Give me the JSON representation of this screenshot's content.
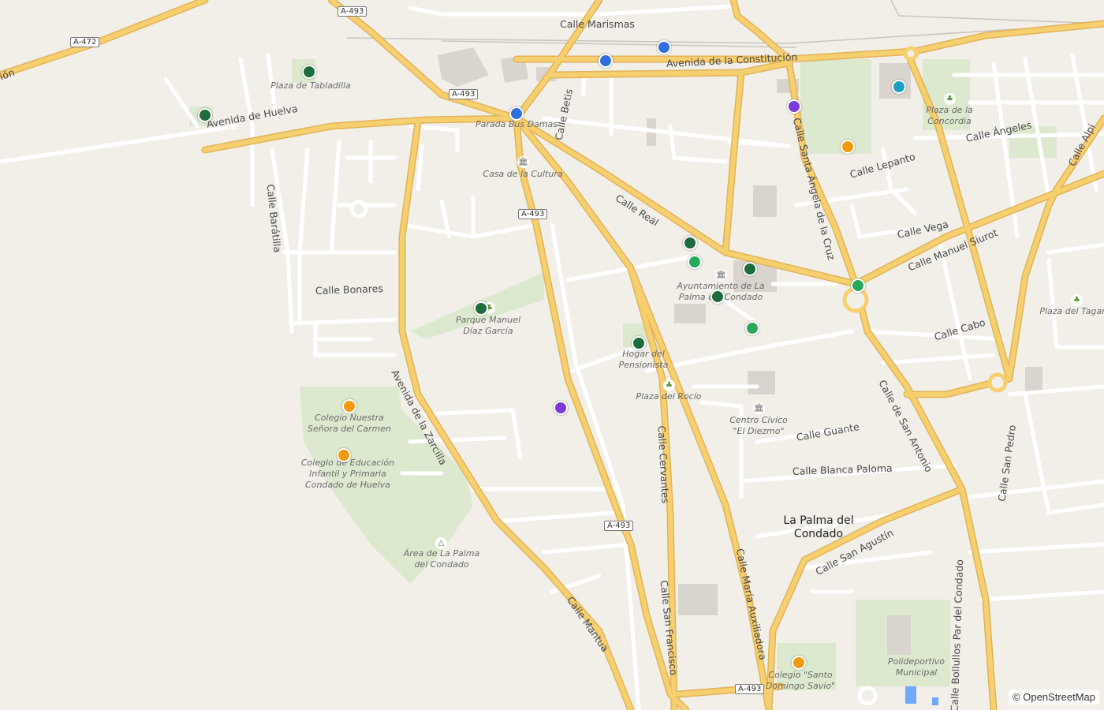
{
  "colors": {
    "background": "#f2efe9",
    "major_road": "#f6cf6f",
    "road_casing": "#e2b35a",
    "minor_road": "#ffffff",
    "park": "#dde9cf",
    "marker_dark_green": "#1f6b3d",
    "marker_green": "#27a85a",
    "marker_blue": "#2e6fdd",
    "marker_purple": "#7a3bd4",
    "marker_orange": "#f19a0f",
    "marker_teal": "#1d9ec2"
  },
  "road_shields": [
    "A-493",
    "A-472",
    "A-493",
    "A-493",
    "A-493",
    "A-493"
  ],
  "streets": [
    "Calle Marismas",
    "Avenida de la Constitución",
    "Avenida de Huelva",
    "Calle Betis",
    "Calle Real",
    "Calle Barátilla",
    "Calle Bonares",
    "Avenida de la Zarcilla",
    "Calle Santa Ángela de la Cruz",
    "Calle Lepanto",
    "Calle Ángeles",
    "Calle Vega",
    "Calle Manuel Siurot",
    "Calle Cabo",
    "Calle de San Antonio",
    "Calle Guante",
    "Calle Blanca Paloma",
    "Calle San Agustín",
    "Calle Cervantes",
    "Calle San Francisco",
    "Calle María Auxiliadora",
    "Calle Mantua",
    "Calle San Pedro",
    "Calle Bollullos Par del Condado",
    "Calle Alpi",
    "ión"
  ],
  "places": [
    "Plaza de Tabladilla",
    "Parada Bus Damas",
    "Casa de la Cultura",
    "Plaza de la\nConcordia",
    "Ayuntamiento de La\nPalma del Condado",
    "Parque Manuel\nDíaz García",
    "Hogar del\nPensionista",
    "Plaza del Rocío",
    "Centro Cívico\n\"El Diezmo\"",
    "Plaza del Tagar",
    "Colegio Nuestra\nSeñora del Carmen",
    "Colegio de Educación\nInfantil y Primaria\nCondado de Huelva",
    "Área de La Palma\ndel Condado",
    "Colegio \"Santo\nDomingo Savio\"",
    "Polideportivo\nMunicipal"
  ],
  "town": "La Palma del\nCondado",
  "attribution": "© OpenStreetMap",
  "markers": [
    {
      "name": "marker-dark-green-1",
      "color": "marker_dark_green"
    },
    {
      "name": "marker-dark-green-2",
      "color": "marker_dark_green"
    },
    {
      "name": "marker-blue-1",
      "color": "marker_blue"
    },
    {
      "name": "marker-blue-2",
      "color": "marker_blue"
    },
    {
      "name": "marker-blue-3",
      "color": "marker_blue"
    },
    {
      "name": "marker-purple-1",
      "color": "marker_purple"
    },
    {
      "name": "marker-teal-1",
      "color": "marker_teal"
    },
    {
      "name": "marker-orange-1",
      "color": "marker_orange"
    },
    {
      "name": "marker-dark-green-3",
      "color": "marker_dark_green"
    },
    {
      "name": "marker-green-1",
      "color": "marker_green"
    },
    {
      "name": "marker-dark-green-4",
      "color": "marker_dark_green"
    },
    {
      "name": "marker-dark-green-5",
      "color": "marker_dark_green"
    },
    {
      "name": "marker-green-2",
      "color": "marker_green"
    },
    {
      "name": "marker-dark-green-6",
      "color": "marker_dark_green"
    },
    {
      "name": "marker-green-3",
      "color": "marker_green"
    },
    {
      "name": "marker-dark-green-7",
      "color": "marker_dark_green"
    },
    {
      "name": "marker-purple-2",
      "color": "marker_purple"
    },
    {
      "name": "marker-orange-2",
      "color": "marker_orange"
    },
    {
      "name": "marker-orange-3",
      "color": "marker_orange"
    },
    {
      "name": "marker-orange-4",
      "color": "marker_orange"
    }
  ]
}
